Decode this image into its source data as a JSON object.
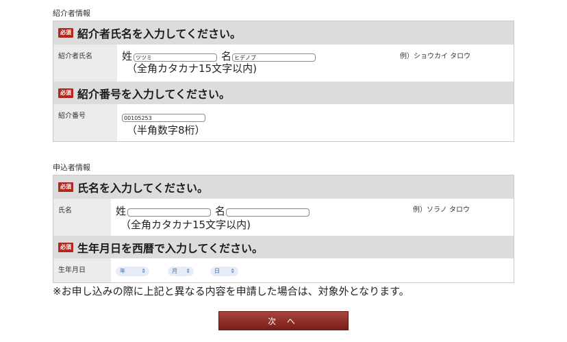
{
  "referrer_section": {
    "title": "紹介者情報",
    "required_badge": "必須",
    "name_question": "紹介者氏名を入力してください。",
    "name_label": "紹介者氏名",
    "sei_prefix": "姓",
    "sei_value": "ツツミ",
    "mei_prefix": "名",
    "mei_value": "ヒデノブ",
    "name_hint": "（全角カタカナ15文字以内)",
    "name_example": "例）ショウカイ タロウ",
    "number_question": "紹介番号を入力してください。",
    "number_label": "紹介番号",
    "number_value": "00105253",
    "number_hint": "（半角数字8桁）"
  },
  "applicant_section": {
    "title": "申込者情報",
    "required_badge": "必須",
    "name_question": "氏名を入力してください。",
    "name_label": "氏名",
    "sei_prefix": "姓",
    "sei_value": "",
    "mei_prefix": "名",
    "mei_value": "",
    "name_hint": "（全角カタカナ15文字以内)",
    "name_example": "例）ソラノ タロウ",
    "dob_question": "生年月日を西暦で入力してください。",
    "dob_label": "生年月日",
    "year_select": "年",
    "month_select": "月",
    "day_select": "日",
    "select_arrow": "⇕"
  },
  "notice": "※お申し込みの際に上記と異なる内容を申請した場合は、対象外となります。",
  "next_button": "次 へ",
  "colors": {
    "required_badge": "#b3271f",
    "header_bg": "#dcdcdc",
    "label_bg": "#ececec",
    "button": "#8f2c26"
  }
}
